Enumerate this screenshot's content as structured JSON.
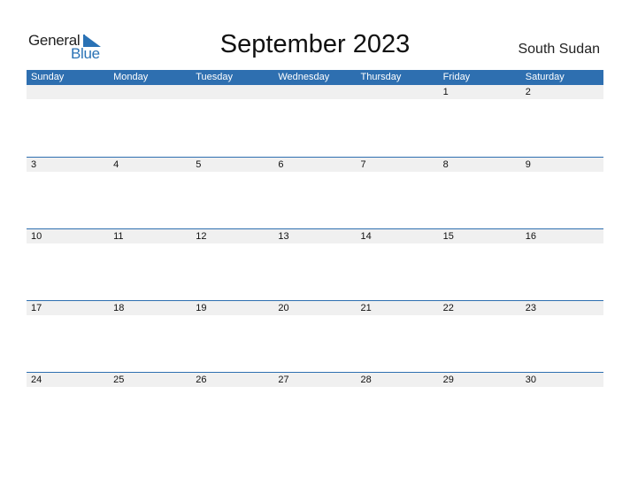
{
  "logo": {
    "general": "General",
    "blue": "Blue"
  },
  "title": "September 2023",
  "country": "South Sudan",
  "weekdays": [
    "Sunday",
    "Monday",
    "Tuesday",
    "Wednesday",
    "Thursday",
    "Friday",
    "Saturday"
  ],
  "weeks": [
    [
      "",
      "",
      "",
      "",
      "",
      "1",
      "2"
    ],
    [
      "3",
      "4",
      "5",
      "6",
      "7",
      "8",
      "9"
    ],
    [
      "10",
      "11",
      "12",
      "13",
      "14",
      "15",
      "16"
    ],
    [
      "17",
      "18",
      "19",
      "20",
      "21",
      "22",
      "23"
    ],
    [
      "24",
      "25",
      "26",
      "27",
      "28",
      "29",
      "30"
    ]
  ],
  "colors": {
    "accent": "#2e6fb0",
    "date_strip": "#f0f0f0"
  }
}
